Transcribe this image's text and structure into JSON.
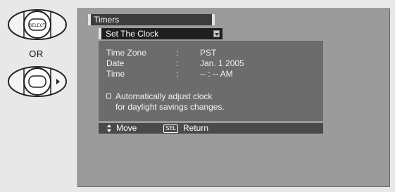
{
  "remote": {
    "select_button_label": "SELECT",
    "or_label": "OR",
    "top_button_icon": "select-button-icon",
    "bottom_button_icon": "right-arrow-button-icon"
  },
  "menu": {
    "title": "Timers",
    "submenu_title": "Set The Clock",
    "fields": [
      {
        "label": "Time Zone",
        "separator": ":",
        "value": "PST"
      },
      {
        "label": "Date",
        "separator": ":",
        "value": "Jan. 1 2005"
      },
      {
        "label": "Time",
        "separator": ":",
        "value": "-- : -- AM"
      }
    ],
    "dst_option": {
      "line1": "Automatically adjust clock",
      "line2": "for daylight savings changes."
    },
    "footer": {
      "move_label": "Move",
      "sel_key": "SEL",
      "return_label": "Return"
    }
  },
  "colors": {
    "background": "#e8e8e8",
    "screen": "#9b9b9b",
    "panel": "#6c6c6c",
    "title_bar": "#3c3c3c",
    "submenu_bar": "#1f1f1f",
    "footer_bar": "#4a4a4a",
    "text": "#ffffff"
  }
}
